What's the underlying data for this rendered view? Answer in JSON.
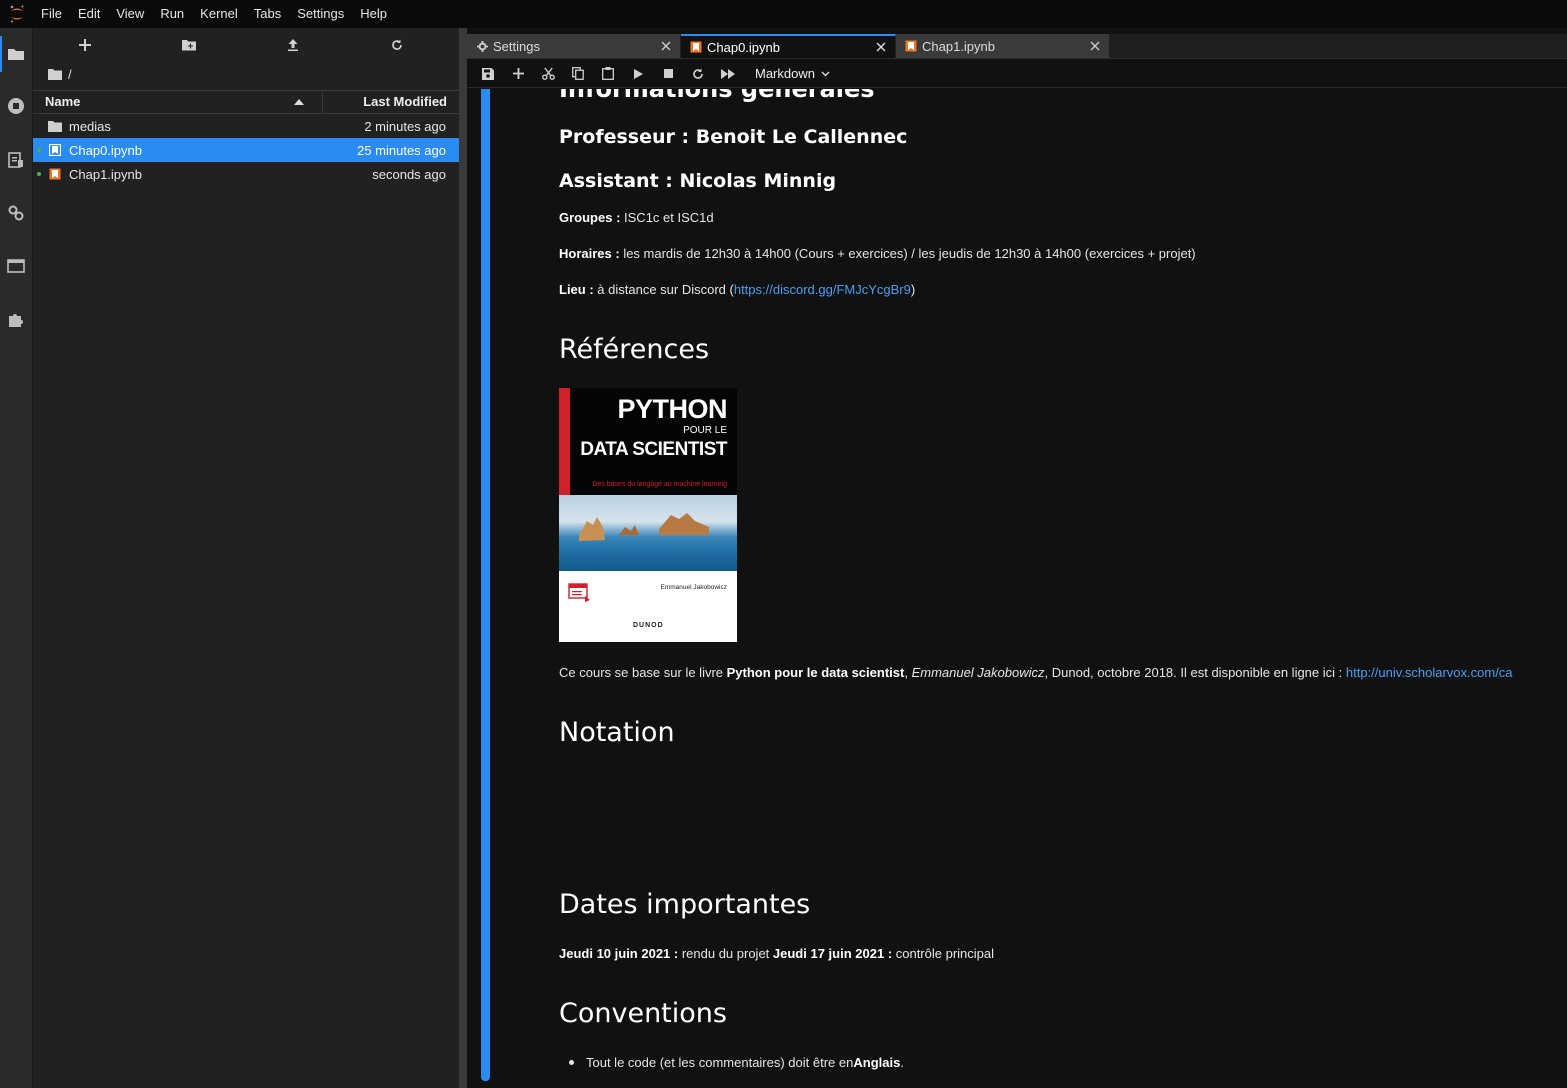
{
  "menubar": {
    "items": [
      "File",
      "Edit",
      "View",
      "Run",
      "Kernel",
      "Tabs",
      "Settings",
      "Help"
    ]
  },
  "filebrowser": {
    "breadcrumb": "/",
    "columns": {
      "name": "Name",
      "modified": "Last Modified"
    },
    "files": [
      {
        "name": "medias",
        "modified": "2 minutes ago",
        "type": "folder-icon",
        "running": false,
        "selected": false
      },
      {
        "name": "Chap0.ipynb",
        "modified": "25 minutes ago",
        "type": "notebook-icon",
        "running": true,
        "selected": true
      },
      {
        "name": "Chap1.ipynb",
        "modified": "seconds ago",
        "type": "notebook-icon",
        "running": true,
        "selected": false
      }
    ]
  },
  "tabs": [
    {
      "label": "Settings",
      "icon": "gear-icon",
      "active": false
    },
    {
      "label": "Chap0.ipynb",
      "icon": "notebook-icon",
      "active": true
    },
    {
      "label": "Chap1.ipynb",
      "icon": "notebook-icon",
      "active": false
    }
  ],
  "toolbar": {
    "cell_type": "Markdown"
  },
  "notebook": {
    "h_info": "Informations générales",
    "professor": "Professeur : Benoit Le Callennec",
    "assistant": "Assistant : Nicolas Minnig",
    "groups_label": "Groupes :",
    "groups_value": " ISC1c et ISC1d",
    "hours_label": "Horaires :",
    "hours_value": " les mardis de 12h30 à 14h00 (Cours + exercices) / les jeudis de 12h30 à 14h00 (exercices + projet)",
    "place_label": "Lieu :",
    "place_value": " à distance sur Discord (",
    "place_link": "https://discord.gg/FMJcYcgBr9",
    "place_end": ")",
    "h_references": "Références",
    "book": {
      "title_line1": "PYTHON",
      "title_line2": "POUR LE",
      "title_line3": "DATA SCIENTIST",
      "subtitle": "Des bases du langage au machine learning",
      "author": "Emmanuel Jakobowicz",
      "publisher": "DUNOD"
    },
    "ref_prefix": "Ce cours se base sur le livre ",
    "ref_book": "Python pour le data scientist",
    "ref_comma": ", ",
    "ref_author": "Emmanuel Jakobowicz",
    "ref_rest": ", Dunod, octobre 2018. Il est disponible en ligne ici : ",
    "ref_link": "http://univ.scholarvox.com/ca",
    "h_notation": "Notation",
    "h_dates": "Dates importantes",
    "date1_label": "Jeudi 10 juin 2021 :",
    "date1_value": " rendu du projet ",
    "date2_label": "Jeudi 17 juin 2021 :",
    "date2_value": " contrôle principal",
    "h_conventions": "Conventions",
    "conv1_text": "Tout le code (et les commentaires) doit être en ",
    "conv1_bold": "Anglais",
    "conv1_end": "."
  },
  "colors": {
    "accent": "#2a8bf2",
    "notebook_icon": "#f37626",
    "running_dot": "#4caf50",
    "link": "#4a9ff0"
  }
}
